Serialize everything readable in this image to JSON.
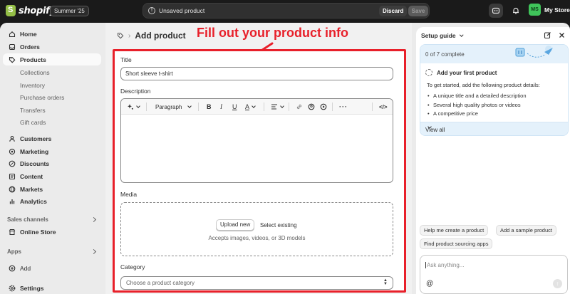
{
  "topbar": {
    "logo_text": "shopify",
    "badge": "Summer '25",
    "unsaved_text": "Unsaved product",
    "discard_label": "Discard",
    "save_label": "Save",
    "store_initials": "MS",
    "store_name": "My Store"
  },
  "sidebar": {
    "items": [
      {
        "label": "Home",
        "icon": "home-icon"
      },
      {
        "label": "Orders",
        "icon": "inbox-icon"
      },
      {
        "label": "Products",
        "icon": "tag-icon"
      },
      {
        "label": "Collections"
      },
      {
        "label": "Inventory"
      },
      {
        "label": "Purchase orders"
      },
      {
        "label": "Transfers"
      },
      {
        "label": "Gift cards"
      },
      {
        "label": "Customers",
        "icon": "person-icon"
      },
      {
        "label": "Marketing",
        "icon": "target-icon"
      },
      {
        "label": "Discounts",
        "icon": "discount-icon"
      },
      {
        "label": "Content",
        "icon": "content-icon"
      },
      {
        "label": "Markets",
        "icon": "globe-icon"
      },
      {
        "label": "Analytics",
        "icon": "chart-icon"
      }
    ],
    "sales_channels_label": "Sales channels",
    "online_store_label": "Online Store",
    "apps_label": "Apps",
    "add_label": "Add",
    "settings_label": "Settings"
  },
  "main": {
    "page_title": "Add product",
    "annotation": "Fill out your product info",
    "title_label": "Title",
    "title_value": "Short sleeve t-shirt",
    "description_label": "Description",
    "toolbar": {
      "paragraph": "Paragraph",
      "bold": "B",
      "italic": "I",
      "underline": "U",
      "color": "A"
    },
    "media_label": "Media",
    "upload_new": "Upload new",
    "select_existing": "Select existing",
    "media_hint": "Accepts images, videos, or 3D models",
    "category_label": "Category",
    "category_placeholder": "Choose a product category"
  },
  "panel": {
    "title": "Setup guide",
    "progress": "0 of 7 complete",
    "progress_fraction": 0,
    "task_title": "Add your first product",
    "task_desc": "To get started, add the following product details:",
    "bullets": [
      "A unique title and a detailed description",
      "Several high quality photos or videos",
      "A competitive price"
    ],
    "view_all": "View all",
    "chips": [
      "Help me create a product",
      "Add a sample product",
      "Find product sourcing apps"
    ],
    "ask_placeholder": "Ask anything...",
    "at_symbol": "@"
  },
  "colors": {
    "accent_red": "#e8202a",
    "store_green": "#3fc45a",
    "guide_blue": "#e4f1fb"
  }
}
